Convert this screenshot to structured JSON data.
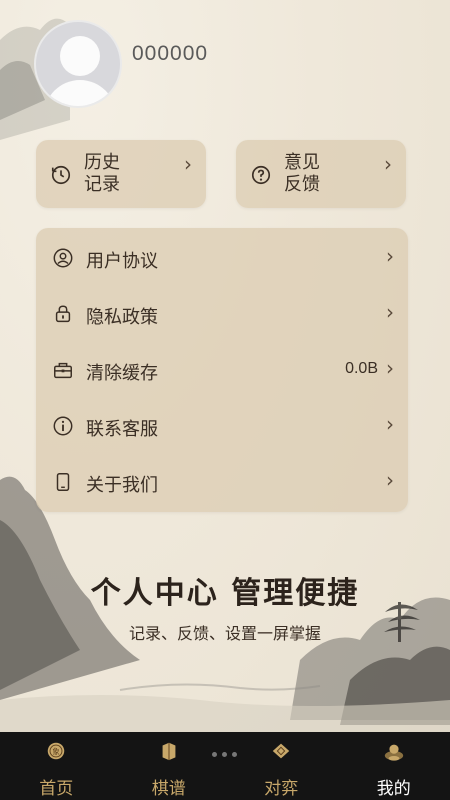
{
  "profile": {
    "username": "000000"
  },
  "quick_actions": [
    {
      "label": "历史\n记录",
      "icon": "history-icon"
    },
    {
      "label": "意见\n反馈",
      "icon": "help-icon"
    }
  ],
  "menu": [
    {
      "label": "用户协议",
      "icon": "user-icon",
      "value": ""
    },
    {
      "label": "隐私政策",
      "icon": "lock-icon",
      "value": ""
    },
    {
      "label": "清除缓存",
      "icon": "clear-icon",
      "value": "0.0B"
    },
    {
      "label": "联系客服",
      "icon": "info-icon",
      "value": ""
    },
    {
      "label": "关于我们",
      "icon": "phone-icon",
      "value": ""
    }
  ],
  "promo": {
    "title": "个人中心 管理便捷",
    "subtitle": "记录、反馈、设置一屏掌握"
  },
  "tabs": [
    {
      "label": "首页",
      "icon": "home-chess-icon"
    },
    {
      "label": "棋谱",
      "icon": "book-icon"
    },
    {
      "label": "对弈",
      "icon": "board-icon"
    },
    {
      "label": "我的",
      "icon": "profile-icon"
    }
  ],
  "colors": {
    "tab_accent": "#c8a86a",
    "tab_active": "#ffffff",
    "card_bg": "#ddcdb4"
  }
}
